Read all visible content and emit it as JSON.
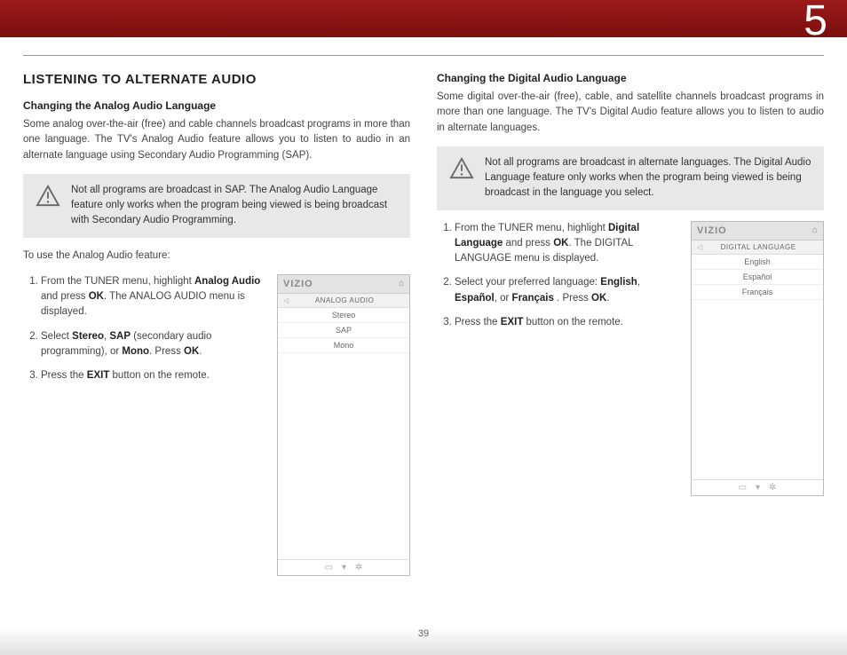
{
  "chapter": "5",
  "section_title": "LISTENING TO ALTERNATE AUDIO",
  "page_number": "39",
  "left": {
    "subheading": "Changing the Analog Audio Language",
    "intro": "Some analog over-the-air (free) and cable channels broadcast programs in more than one language. The TV's Analog Audio feature allows you to listen to audio in an alternate language using Secondary Audio Programming (SAP).",
    "note": "Not all programs are broadcast in SAP. The Analog Audio Language feature only works when the program being viewed is being broadcast with Secondary Audio Programming.",
    "lead_in": "To use the Analog Audio feature:",
    "steps": {
      "s1a": "From the TUNER menu, highlight ",
      "s1b": "Analog Audio",
      "s1c": " and press ",
      "s1d": "OK",
      "s1e": ". The ANALOG AUDIO menu is displayed.",
      "s2a": "Select ",
      "s2b": "Stereo",
      "s2c": ", ",
      "s2d": "SAP",
      "s2e": " (secondary audio programming), or ",
      "s2f": "Mono",
      "s2g": ". Press ",
      "s2h": "OK",
      "s2i": ".",
      "s3a": "Press the ",
      "s3b": "EXIT",
      "s3c": " button on the remote."
    },
    "menu": {
      "brand": "VIZIO",
      "title": "ANALOG AUDIO",
      "items": [
        "Stereo",
        "SAP",
        "Mono"
      ]
    }
  },
  "right": {
    "subheading": "Changing the Digital Audio Language",
    "intro": "Some digital over-the-air (free), cable, and satellite channels broadcast programs in more than one language. The TV's Digital Audio feature allows you to listen to audio in alternate languages.",
    "note": "Not all programs are broadcast in alternate languages. The Digital Audio Language feature only works when the program being viewed is being broadcast in the language you select.",
    "steps": {
      "s1a": "From the TUNER menu, highlight ",
      "s1b": "Digital Language",
      "s1c": " and press ",
      "s1d": "OK",
      "s1e": ". The DIGITAL LANGUAGE menu is displayed.",
      "s2a": "Select your preferred language: ",
      "s2b": "English",
      "s2c": ", ",
      "s2d": "Español",
      "s2e": ",  or ",
      "s2f": "Français",
      "s2g": " . Press ",
      "s2h": "OK",
      "s2i": ".",
      "s3a": "Press the ",
      "s3b": "EXIT",
      "s3c": " button on the remote."
    },
    "menu": {
      "brand": "VIZIO",
      "title": "DIGITAL LANGUAGE",
      "items": [
        "English",
        "Español",
        "Français"
      ]
    }
  }
}
